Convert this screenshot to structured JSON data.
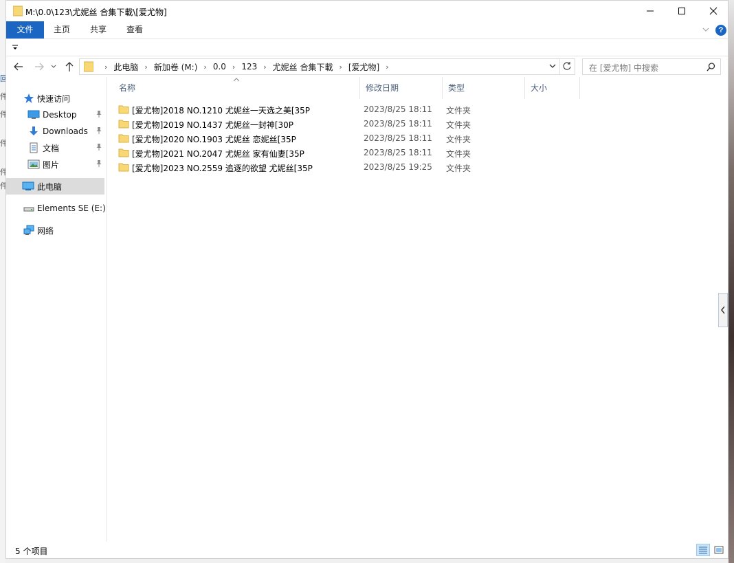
{
  "window": {
    "title": "M:\\0.0\\123\\尤妮丝 合集下載\\[爱尤物]"
  },
  "ribbon": {
    "tabs": [
      {
        "label": "文件"
      },
      {
        "label": "主页"
      },
      {
        "label": "共享"
      },
      {
        "label": "查看"
      }
    ]
  },
  "address": {
    "crumbs": [
      "此电脑",
      "新加卷 (M:)",
      "0.0",
      "123",
      "尤妮丝 合集下載",
      "[爱尤物]"
    ]
  },
  "search": {
    "placeholder": "在 [爱尤物] 中搜索"
  },
  "sidebar": {
    "quick_access": "快速访问",
    "items": [
      {
        "label": "Desktop"
      },
      {
        "label": "Downloads"
      },
      {
        "label": "文档"
      },
      {
        "label": "图片"
      }
    ],
    "this_pc": "此电脑",
    "drive": "Elements SE (E:)",
    "network": "网络"
  },
  "columns": {
    "name": "名称",
    "date": "修改日期",
    "type": "类型",
    "size": "大小"
  },
  "files": [
    {
      "name": "[爱尤物]2018 NO.1210 尤妮丝一天选之美[35P",
      "date": "2023/8/25 18:11",
      "type": "文件夹"
    },
    {
      "name": "[爱尤物]2019 NO.1437 尤妮丝一封神[30P",
      "date": "2023/8/25 18:11",
      "type": "文件夹"
    },
    {
      "name": "[爱尤物]2020 NO.1903 尤妮丝 恋妮丝[35P",
      "date": "2023/8/25 18:11",
      "type": "文件夹"
    },
    {
      "name": "[爱尤物]2021 NO.2047 尤妮丝 家有仙妻[35P",
      "date": "2023/8/25 18:11",
      "type": "文件夹"
    },
    {
      "name": "[爱尤物]2023 NO.2559 追逐的欲望 尤妮丝[35P",
      "date": "2023/8/25 19:25",
      "type": "文件夹"
    }
  ],
  "status": {
    "count": "5 个项目"
  },
  "desktop_left": {
    "glyphs": [
      "件",
      "件",
      "件",
      "件",
      "件"
    ]
  },
  "colors": {
    "accent": "#1a66c2",
    "folder": "#f8d775",
    "selection": "#dcdcdc"
  }
}
